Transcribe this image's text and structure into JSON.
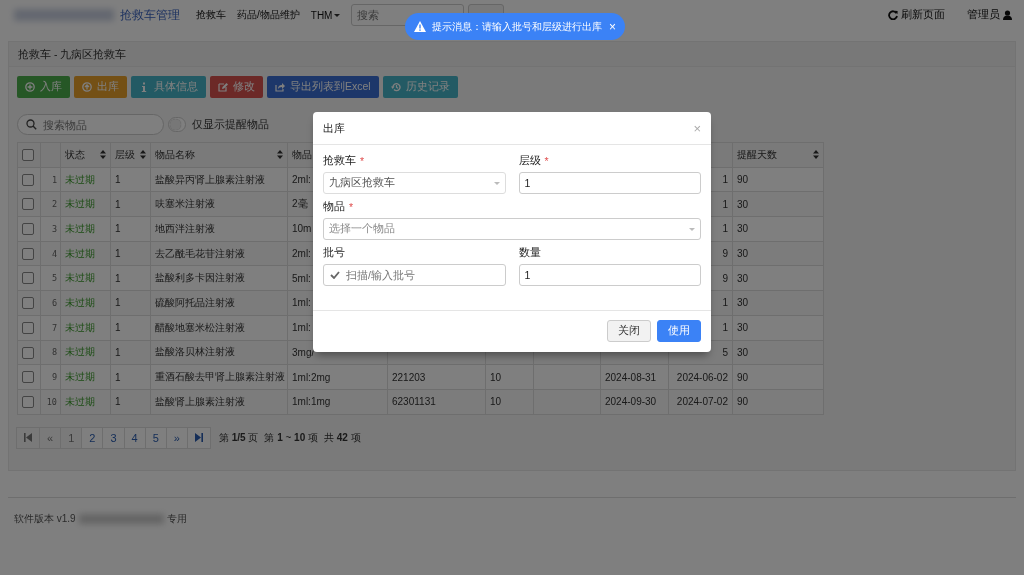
{
  "navbar": {
    "brand": "抢救车管理",
    "nav_items": [
      {
        "label": "抢救车",
        "kind": "link"
      },
      {
        "label": "药品/物品维护",
        "kind": "link"
      },
      {
        "label": "THM",
        "kind": "dropdown"
      }
    ],
    "search": {
      "placeholder": "搜索"
    },
    "right_items": [
      {
        "label": "刷新页面",
        "kind": "refresh"
      },
      {
        "label": "管理员",
        "kind": "user"
      }
    ]
  },
  "toast": {
    "message": "提示消息：请输入批号和层级进行出库",
    "close": "×"
  },
  "panel": {
    "title": "抢救车 - 九病区抢救车"
  },
  "toolbar": [
    {
      "label": "入库",
      "kind": "in"
    },
    {
      "label": "出库",
      "kind": "out"
    },
    {
      "label": "具体信息",
      "kind": "info"
    },
    {
      "label": "修改",
      "kind": "edit"
    },
    {
      "label": "导出列表到Excel",
      "kind": "export"
    },
    {
      "label": "历史记录",
      "kind": "history"
    }
  ],
  "filter": {
    "placeholder": "搜索物品",
    "toggle": {
      "label": "仅显示提醒物品",
      "on": false
    }
  },
  "table": {
    "select_all": {
      "checked": false
    },
    "columns": [
      {},
      {},
      {
        "label": "状态",
        "sortable": true
      },
      {
        "label": "层级",
        "sortable": true
      },
      {
        "label": "物品名称",
        "sortable": true
      },
      {
        "label": "物品"
      },
      {},
      {},
      {},
      {},
      {},
      {
        "label": "提醒天数",
        "sortable": true
      }
    ],
    "rows": [
      {
        "checked": false,
        "expired": false,
        "number": "1",
        "status": "未过期",
        "level": "1",
        "name": "盐酸异丙肾上腺素注射液",
        "spec": "2ml:",
        "date": "1",
        "remind_days": "90"
      },
      {
        "checked": false,
        "expired": false,
        "number": "2",
        "status": "未过期",
        "level": "1",
        "name": "呋塞米注射液",
        "spec": "2毫",
        "date": "1",
        "remind_days": "30"
      },
      {
        "checked": false,
        "expired": false,
        "number": "3",
        "status": "未过期",
        "level": "1",
        "name": "地西泮注射液",
        "spec": "10m",
        "date": "1",
        "remind_days": "30"
      },
      {
        "checked": false,
        "expired": false,
        "number": "4",
        "status": "未过期",
        "level": "1",
        "name": "去乙酰毛花苷注射液",
        "spec": "2ml:",
        "date": "9",
        "remind_days": "30"
      },
      {
        "checked": false,
        "expired": false,
        "number": "5",
        "status": "未过期",
        "level": "1",
        "name": "盐酸利多卡因注射液",
        "spec": "5ml:",
        "date": "9",
        "remind_days": "30"
      },
      {
        "checked": false,
        "expired": false,
        "number": "6",
        "status": "未过期",
        "level": "1",
        "name": "硫酸阿托品注射液",
        "spec": "1ml:",
        "date": "1",
        "remind_days": "30"
      },
      {
        "checked": false,
        "expired": false,
        "number": "7",
        "status": "未过期",
        "level": "1",
        "name": "醋酸地塞米松注射液",
        "spec": "1ml:",
        "date": "1",
        "remind_days": "30"
      },
      {
        "checked": false,
        "expired": false,
        "number": "8",
        "status": "未过期",
        "level": "1",
        "name": "盐酸洛贝林注射液",
        "spec": "3mg/",
        "date": "5",
        "remind_days": "30"
      },
      {
        "checked": false,
        "expired": false,
        "number": "9",
        "status": "未过期",
        "level": "1",
        "name": "重酒石酸去甲肾上腺素注射液",
        "spec": "1ml:2mg",
        "batch": "221203",
        "quantity": "10",
        "expiry": "2024-08-31",
        "date": "2024-06-02",
        "remind_days": "90"
      },
      {
        "checked": false,
        "expired": false,
        "number": "10",
        "status": "未过期",
        "level": "1",
        "name": "盐酸肾上腺素注射液",
        "spec": "1ml:1mg",
        "batch": "62301131",
        "quantity": "10",
        "expiry": "2024-09-30",
        "date": "2024-07-02",
        "remind_days": "90"
      }
    ]
  },
  "pagination": {
    "pages": [
      {
        "kind": "first",
        "disabled": true
      },
      {
        "kind": "text",
        "label": "«",
        "disabled": true
      },
      {
        "kind": "text",
        "label": "1",
        "disabled": true
      },
      {
        "kind": "text",
        "label": "2",
        "disabled": false
      },
      {
        "kind": "text",
        "label": "3",
        "disabled": false
      },
      {
        "kind": "text",
        "label": "4",
        "disabled": false
      },
      {
        "kind": "text",
        "label": "5",
        "disabled": false
      },
      {
        "kind": "text",
        "label": "»",
        "disabled": false
      },
      {
        "kind": "last",
        "disabled": false
      }
    ],
    "info": [
      "第 **1/5** 页",
      "第 **1** ~ **10** 项",
      "共 **42** 项"
    ]
  },
  "footer": {
    "version": "软件版本 v1.9",
    "suffix": "专用"
  },
  "modal": {
    "title": "出库",
    "close": "×",
    "field_rows": [
      [
        {
          "label": "抢救车",
          "required_mark": "*",
          "kind": "select",
          "value": "九病区抢救车",
          "disabled": true
        },
        {
          "label": "层级",
          "required_mark": "*",
          "kind": "input",
          "value": "1",
          "disabled": false
        }
      ],
      [
        {
          "label": "物品",
          "required_mark": "*",
          "kind": "select",
          "placeholder": "选择一个物品",
          "disabled": false
        }
      ],
      [
        {
          "label": "批号",
          "kind": "icon-input",
          "placeholder": "扫描/输入批号",
          "disabled": false
        },
        {
          "label": "数量",
          "kind": "input",
          "value": "1",
          "disabled": false
        }
      ]
    ],
    "buttons": [
      {
        "label": "关闭",
        "kind": "default"
      },
      {
        "label": "使用",
        "kind": "primary"
      }
    ]
  }
}
